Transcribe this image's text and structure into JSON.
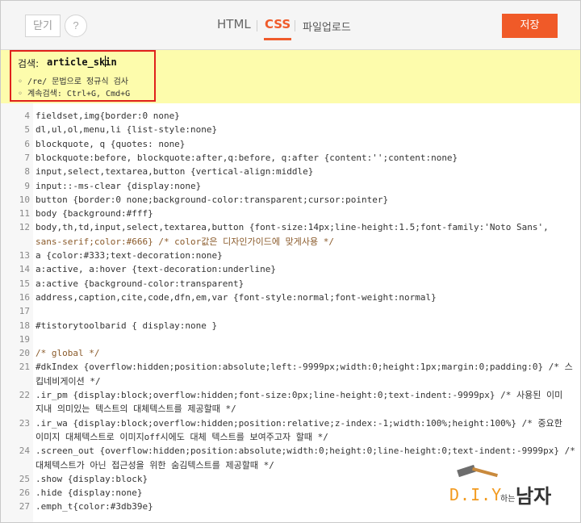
{
  "topbar": {
    "close_label": "닫기",
    "help_label": "?",
    "tabs": [
      {
        "label": "HTML"
      },
      {
        "label": "CSS"
      },
      {
        "label": "파일업로드"
      }
    ],
    "save_label": "저장"
  },
  "search": {
    "label": "검색:",
    "value": "article_skin",
    "hints": [
      "/re/ 문법으로 정규식 검사",
      "계속검색: Ctrl+G, Cmd+G"
    ]
  },
  "editor": {
    "lines": [
      {
        "n": "4",
        "text": "fieldset,img{border:0 none}"
      },
      {
        "n": "5",
        "text": "dl,ul,ol,menu,li {list-style:none}"
      },
      {
        "n": "6",
        "text": "blockquote, q {quotes: none}"
      },
      {
        "n": "7",
        "text": "blockquote:before, blockquote:after,q:before, q:after {content:'';content:none}"
      },
      {
        "n": "8",
        "text": "input,select,textarea,button {vertical-align:middle}"
      },
      {
        "n": "9",
        "text": "input::-ms-clear {display:none}"
      },
      {
        "n": "10",
        "text": "button {border:0 none;background-color:transparent;cursor:pointer}"
      },
      {
        "n": "11",
        "text": "body {background:#fff}"
      },
      {
        "n": "12",
        "text": "body,th,td,input,select,textarea,button {font-size:14px;line-height:1.5;font-family:'Noto Sans',"
      },
      {
        "n": "",
        "text": "sans-serif;color:#666} /* color값은 디자인가이드에 맞게사용 */"
      },
      {
        "n": "13",
        "text": "a {color:#333;text-decoration:none}"
      },
      {
        "n": "14",
        "text": "a:active, a:hover {text-decoration:underline}"
      },
      {
        "n": "15",
        "text": "a:active {background-color:transparent}"
      },
      {
        "n": "16",
        "text": "address,caption,cite,code,dfn,em,var {font-style:normal;font-weight:normal}"
      },
      {
        "n": "17",
        "text": ""
      },
      {
        "n": "18",
        "text": "#tistorytoolbarid { display:none }"
      },
      {
        "n": "19",
        "text": ""
      },
      {
        "n": "20",
        "text": "/* global */"
      },
      {
        "n": "21",
        "text": "#dkIndex {overflow:hidden;position:absolute;left:-9999px;width:0;height:1px;margin:0;padding:0} /* 스"
      },
      {
        "n": "",
        "text": "킵네비게이션 */"
      },
      {
        "n": "22",
        "text": ".ir_pm {display:block;overflow:hidden;font-size:0px;line-height:0;text-indent:-9999px} /* 사용된 이미"
      },
      {
        "n": "",
        "text": "지내 의미있는 텍스트의 대체텍스트를 제공할때 */"
      },
      {
        "n": "23",
        "text": ".ir_wa {display:block;overflow:hidden;position:relative;z-index:-1;width:100%;height:100%} /* 중요한"
      },
      {
        "n": "",
        "text": "이미지 대체텍스트로 이미지off시에도 대체 텍스트를 보여주고자 할때 */"
      },
      {
        "n": "24",
        "text": ".screen_out {overflow:hidden;position:absolute;width:0;height:0;line-height:0;text-indent:-9999px} /*"
      },
      {
        "n": "",
        "text": "대체텍스트가 아닌 접근성을 위한 숨김텍스트를 제공할때 */"
      },
      {
        "n": "25",
        "text": ".show {display:block}"
      },
      {
        "n": "26",
        "text": ".hide {display:none}"
      },
      {
        "n": "27",
        "text": ".emph_t{color:#3db39e}"
      }
    ]
  },
  "watermark": {
    "diy": "D.I.Y",
    "small": "하는",
    "big": "남자"
  },
  "colors": {
    "accent": "#ef5b2b",
    "search_bg": "#fdfcac",
    "search_border": "#e0211b"
  }
}
